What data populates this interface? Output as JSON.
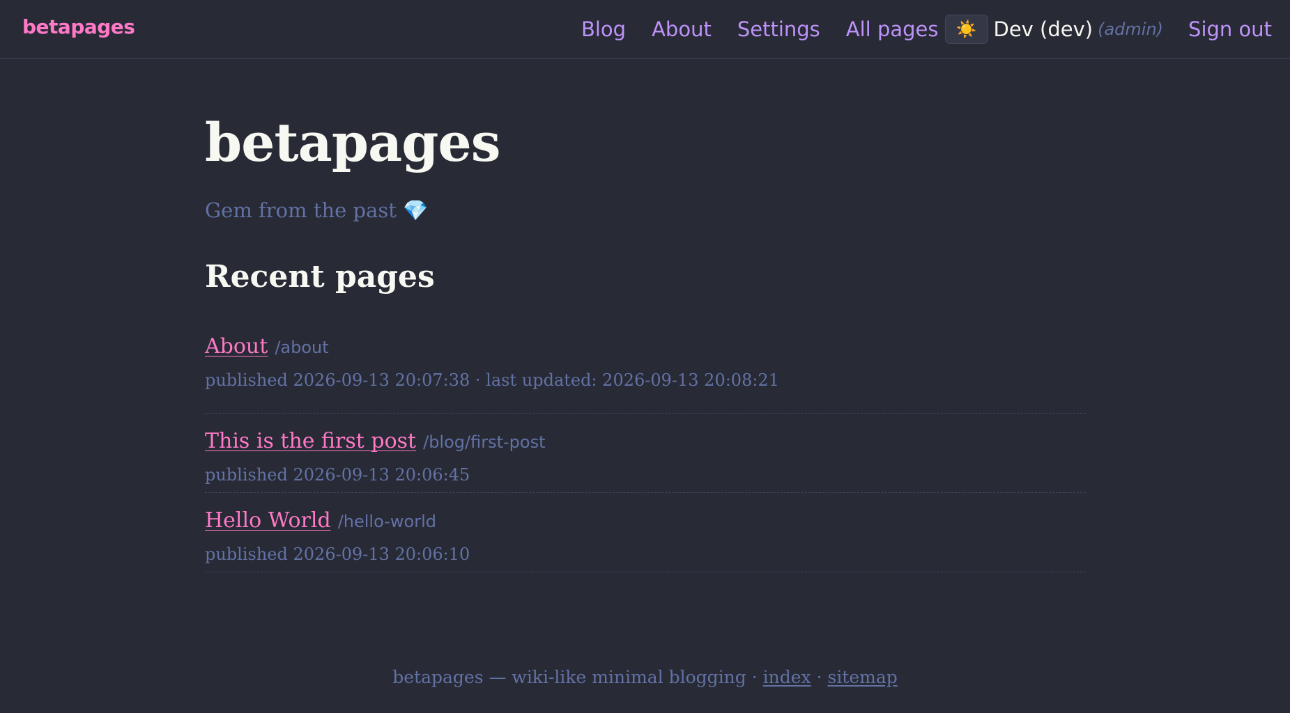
{
  "header": {
    "brand": "betapages",
    "nav": [
      {
        "label": "Blog"
      },
      {
        "label": "About"
      },
      {
        "label": "Settings"
      },
      {
        "label": "All pages"
      }
    ],
    "theme_toggle_icon": "☀️",
    "user_name": "Dev (dev)",
    "user_role": "(admin)",
    "sign_out": "Sign out"
  },
  "main": {
    "title": "betapages",
    "tagline": "Gem from the past 💎",
    "section_title": "Recent pages",
    "pages": [
      {
        "title": "About",
        "path": "/about",
        "meta": "published 2026-09-13 20:07:38 · last updated: 2026-09-13 20:08:21"
      },
      {
        "title": "This is the first post",
        "path": "/blog/first-post",
        "meta": "published 2026-09-13 20:06:45"
      },
      {
        "title": "Hello World",
        "path": "/hello-world",
        "meta": "published 2026-09-13 20:06:10"
      }
    ]
  },
  "footer": {
    "text": "betapages — wiki-like minimal blogging · ",
    "index_link": "index",
    "separator": " · ",
    "sitemap_link": "sitemap"
  },
  "colors": {
    "background": "#282a36",
    "accent_pink": "#ff79c6",
    "accent_purple": "#bd93f9",
    "muted": "#6272a4",
    "foreground": "#f8f8f2"
  }
}
